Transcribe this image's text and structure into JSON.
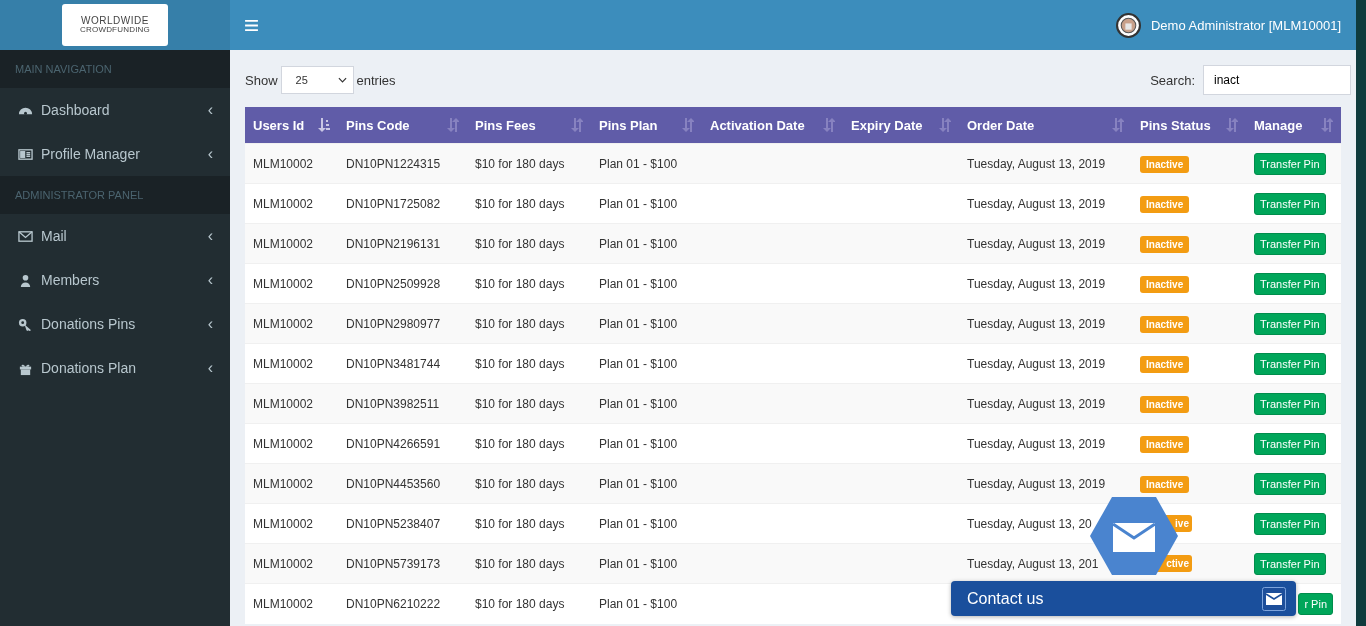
{
  "logo": {
    "line1": "WORLDWIDE",
    "line2": "CROWDFUNDING"
  },
  "header": {
    "user": "Demo Administrator [MLM10001]"
  },
  "sidebar": [
    {
      "kind": "section",
      "label": "MAIN NAVIGATION"
    },
    {
      "kind": "item",
      "label": "Dashboard",
      "caret": "‹"
    },
    {
      "kind": "item",
      "label": "Profile Manager",
      "caret": "‹"
    },
    {
      "kind": "section",
      "label": "ADMINISTRATOR PANEL"
    },
    {
      "kind": "item",
      "label": "Mail",
      "caret": "‹"
    },
    {
      "kind": "item",
      "label": "Members",
      "caret": "‹"
    },
    {
      "kind": "item",
      "label": "Donations Pins",
      "caret": "‹"
    },
    {
      "kind": "item",
      "label": "Donations Plan",
      "caret": "‹"
    }
  ],
  "length": {
    "label_before": "Show",
    "value": "25",
    "label_after": "entries"
  },
  "search": {
    "label": "Search:",
    "value": "inact"
  },
  "table": {
    "columns": [
      {
        "label": "Users Id",
        "sorted": true
      },
      {
        "label": "Pins Code",
        "sorted": false
      },
      {
        "label": "Pins Fees",
        "sorted": false
      },
      {
        "label": "Pins Plan",
        "sorted": false
      },
      {
        "label": "Activation Date",
        "sorted": false
      },
      {
        "label": "Expiry Date",
        "sorted": false
      },
      {
        "label": "Order Date",
        "sorted": false
      },
      {
        "label": "Pins Status",
        "sorted": false
      },
      {
        "label": "Manage",
        "sorted": false
      }
    ],
    "rows": [
      {
        "user": "MLM10002",
        "code": "DN10PN1224315",
        "fees": "$10 for 180 days",
        "plan": "Plan 01 - $100",
        "order": "Tuesday, August 13, 2019",
        "status": "Inactive",
        "manage": "Transfer Pin"
      },
      {
        "user": "MLM10002",
        "code": "DN10PN1725082",
        "fees": "$10 for 180 days",
        "plan": "Plan 01 - $100",
        "order": "Tuesday, August 13, 2019",
        "status": "Inactive",
        "manage": "Transfer Pin"
      },
      {
        "user": "MLM10002",
        "code": "DN10PN2196131",
        "fees": "$10 for 180 days",
        "plan": "Plan 01 - $100",
        "order": "Tuesday, August 13, 2019",
        "status": "Inactive",
        "manage": "Transfer Pin"
      },
      {
        "user": "MLM10002",
        "code": "DN10PN2509928",
        "fees": "$10 for 180 days",
        "plan": "Plan 01 - $100",
        "order": "Tuesday, August 13, 2019",
        "status": "Inactive",
        "manage": "Transfer Pin"
      },
      {
        "user": "MLM10002",
        "code": "DN10PN2980977",
        "fees": "$10 for 180 days",
        "plan": "Plan 01 - $100",
        "order": "Tuesday, August 13, 2019",
        "status": "Inactive",
        "manage": "Transfer Pin"
      },
      {
        "user": "MLM10002",
        "code": "DN10PN3481744",
        "fees": "$10 for 180 days",
        "plan": "Plan 01 - $100",
        "order": "Tuesday, August 13, 2019",
        "status": "Inactive",
        "manage": "Transfer Pin"
      },
      {
        "user": "MLM10002",
        "code": "DN10PN3982511",
        "fees": "$10 for 180 days",
        "plan": "Plan 01 - $100",
        "order": "Tuesday, August 13, 2019",
        "status": "Inactive",
        "manage": "Transfer Pin"
      },
      {
        "user": "MLM10002",
        "code": "DN10PN4266591",
        "fees": "$10 for 180 days",
        "plan": "Plan 01 - $100",
        "order": "Tuesday, August 13, 2019",
        "status": "Inactive",
        "manage": "Transfer Pin"
      },
      {
        "user": "MLM10002",
        "code": "DN10PN4453560",
        "fees": "$10 for 180 days",
        "plan": "Plan 01 - $100",
        "order": "Tuesday, August 13, 2019",
        "status": "Inactive",
        "manage": "Transfer Pin"
      },
      {
        "user": "MLM10002",
        "code": "DN10PN5238407",
        "fees": "$10 for 180 days",
        "plan": "Plan 01 - $100",
        "order": "Tuesday, August 13, 20",
        "status": "ive",
        "manage": "Transfer Pin"
      },
      {
        "user": "MLM10002",
        "code": "DN10PN5739173",
        "fees": "$10 for 180 days",
        "plan": "Plan 01 - $100",
        "order": "Tuesday, August 13, 201",
        "status": "ctive",
        "manage": "Transfer Pin"
      },
      {
        "user": "MLM10002",
        "code": "DN10PN6210222",
        "fees": "$10 for 180 days",
        "plan": "Plan 01 - $100",
        "manage": "r Pin"
      }
    ]
  },
  "contact": {
    "label": "Contact us"
  }
}
